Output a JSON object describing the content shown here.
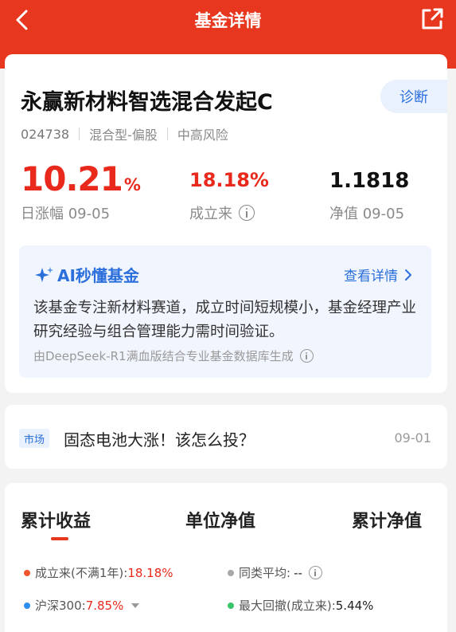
{
  "header": {
    "title": "基金详情",
    "bg_color": "#e8371f"
  },
  "fund": {
    "name": "永赢新材料智选混合发起C",
    "diagnose_label": "诊断",
    "code": "024738",
    "type": "混合型-偏股",
    "risk": "中高风险",
    "daily_change": "10.21",
    "daily_change_unit": "%",
    "daily_change_label": "日涨幅 09-05",
    "since_inception": "18.18%",
    "since_inception_label": "成立来",
    "nav": "1.1818",
    "nav_label": "净值 09-05"
  },
  "ai": {
    "title": "AI秒懂基金",
    "more_label": "查看详情",
    "summary": "该基金专注新材料赛道，成立时间短规模小，基金经理产业研究经验与组合管理能力需时间验证。",
    "note": "由DeepSeek-R1满血版结合专业基金数据库生成"
  },
  "news": {
    "tag": "市场",
    "title": "固态电池大涨！该怎么投？",
    "date": "09-01"
  },
  "tabs": {
    "items": [
      "累计收益",
      "单位净值",
      "累计净值"
    ],
    "active": 0
  },
  "legend": {
    "since_label": "成立来(不满1年):",
    "since_value": "18.18%",
    "peer_label": "同类平均:",
    "peer_value": "--",
    "hs300_label": "沪深300:",
    "hs300_value": "7.85%",
    "drawdown_label": "最大回撤(成立来):",
    "drawdown_value": "5.44%"
  },
  "colors": {
    "up_red": "#e8291c",
    "accent_blue": "#2b6fdc",
    "series_orange": "#f0552b",
    "series_blue": "#2e8ef0",
    "series_gray": "#a8a8a8",
    "series_green": "#3cc46a"
  }
}
